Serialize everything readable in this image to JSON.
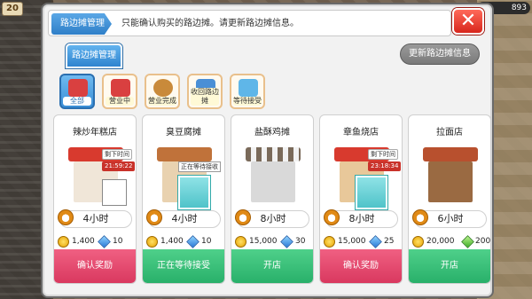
{
  "scene": {
    "level": "20",
    "coins": "893"
  },
  "dialog": {
    "title_tab": "路边摊管理",
    "hint": "只能确认购买的路边摊。请更新路边摊信息。",
    "close_icon": "close-x-icon",
    "section_tab": "路边摊管理",
    "update_button": "更新路边摊信息"
  },
  "filters": [
    {
      "label": "全部",
      "icon": "stall-all-icon",
      "color": "#d94040",
      "active": true
    },
    {
      "label": "营业中",
      "icon": "stall-open-icon",
      "color": "#d94040",
      "active": false
    },
    {
      "label": "营业完成",
      "icon": "money-bag-icon",
      "color": "#c98a3a",
      "active": false
    },
    {
      "label": "收回路边摊",
      "icon": "retrieve-icon",
      "color": "#4a8fd6",
      "active": false
    },
    {
      "label": "等待接受",
      "icon": "waiting-icon",
      "color": "#5fb6e8",
      "active": false
    }
  ],
  "cards": [
    {
      "name": "辣炒年糕店",
      "timer_label": "剩下时间",
      "timer_value": "21:59:22",
      "has_avatar_photo": true,
      "duration": "4小时",
      "cost_coin": "1,400",
      "cost_gem": "10",
      "gem_color": "blue",
      "action": "确认奖励",
      "action_color": "red",
      "roof_color": "#d83a2e",
      "body_color": "#f0e6d8"
    },
    {
      "name": "臭豆腐摊",
      "wait_label": "正在等待接收",
      "has_avatar_placeholder": true,
      "duration": "4小时",
      "cost_coin": "1,400",
      "cost_gem": "10",
      "gem_color": "blue",
      "action": "正在等待接受",
      "action_color": "green",
      "roof_color": "#c0723a",
      "body_color": "#e9d2b0"
    },
    {
      "name": "盐酥鸡摊",
      "duration": "8小时",
      "cost_coin": "15,000",
      "cost_gem": "30",
      "gem_color": "blue",
      "action": "开店",
      "action_color": "green",
      "roof_color": "#7a6a5a",
      "body_color": "#d9d9d9"
    },
    {
      "name": "章鱼烧店",
      "timer_label": "剩下时间",
      "timer_value": "23:18:34",
      "has_avatar_placeholder": true,
      "duration": "8小时",
      "cost_coin": "15,000",
      "cost_gem": "25",
      "gem_color": "blue",
      "action": "确认奖励",
      "action_color": "red",
      "roof_color": "#d83a2e",
      "body_color": "#e8c89a"
    },
    {
      "name": "拉面店",
      "duration": "6小时",
      "cost_coin": "20,000",
      "cost_gem": "200",
      "gem_color": "green",
      "action": "开店",
      "action_color": "green",
      "roof_color": "#b8502e",
      "body_color": "#9a6a42"
    }
  ]
}
